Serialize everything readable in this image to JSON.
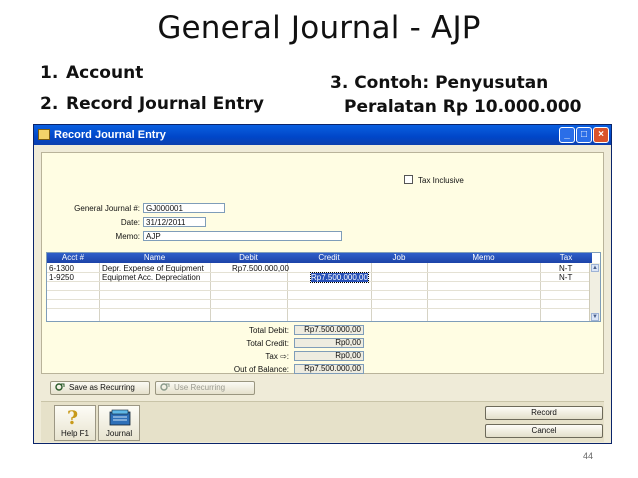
{
  "slide": {
    "title": "General Journal - AJP",
    "bullets": [
      {
        "num": "1.",
        "text": "Account"
      },
      {
        "num": "2.",
        "text": "Record Journal Entry"
      }
    ],
    "example_line1": "3. Contoh: Penyusutan",
    "example_line2": "Peralatan Rp 10.000.000",
    "page_number": "44"
  },
  "window": {
    "title": "Record Journal Entry",
    "controls": {
      "minimize": "_",
      "maximize": "□",
      "close": "×"
    }
  },
  "form": {
    "tax_inclusive_label": "Tax Inclusive",
    "general_journal_label": "General Journal #:",
    "general_journal_value": "GJ000001",
    "date_label": "Date:",
    "date_value": "31/12/2011",
    "memo_label": "Memo:",
    "memo_value": "AJP"
  },
  "grid": {
    "columns": [
      "Acct #",
      "Name",
      "Debit",
      "Credit",
      "Job",
      "Memo",
      "Tax"
    ],
    "rows": [
      {
        "acct": "6-1300",
        "name": "Depr. Expense of Equipment",
        "debit": "Rp7.500.000,00",
        "credit": "",
        "job": "",
        "memo": "",
        "tax": "N-T"
      },
      {
        "acct": "1-9250",
        "name": "Equipmet Acc. Depreciation",
        "debit": "",
        "credit": "Rp7.500.000,00",
        "job": "",
        "memo": "",
        "tax": "N-T"
      }
    ]
  },
  "totals": {
    "total_debit_label": "Total Debit:",
    "total_debit": "Rp7.500.000,00",
    "total_credit_label": "Total Credit:",
    "total_credit": "Rp0,00",
    "tax_label": "Tax ⇨:",
    "tax": "Rp0,00",
    "out_of_balance_label": "Out of Balance:",
    "out_of_balance": "Rp7.500.000,00"
  },
  "buttons": {
    "save_recurring": "Save as Recurring",
    "use_recurring": "Use Recurring",
    "help": "Help F1",
    "journal": "Journal",
    "record": "Record",
    "cancel": "Cancel"
  },
  "colors": {
    "titlebar": "#0046c8",
    "grid_header": "#1c43a8",
    "panel_bg": "#fffde3",
    "selection": "#2750b8"
  }
}
